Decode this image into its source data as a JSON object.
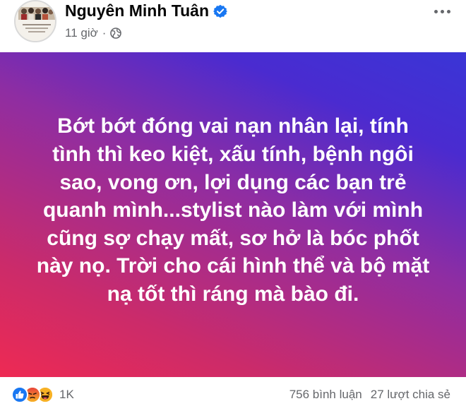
{
  "post": {
    "author": "Nguyên Minh Tuân",
    "timestamp": "11 giờ",
    "verified": true,
    "audience_icon": "globe-icon",
    "banner_text": "Bớt bớt đóng vai nạn nhân lại, tính tình thì keo kiệt, xấu tính, bệnh ngôi sao, vong ơn, lợi dụng các bạn trẻ quanh mình...stylist nào làm với mình cũng sợ chạy mất, sơ hở là bóc phốt này nọ. Trời cho cái hình thể và bộ mặt nạ tốt thì ráng mà bào đi.",
    "banner_colors": [
      "#ee2a53",
      "#8f2da2",
      "#3a35d6"
    ]
  },
  "footer": {
    "reactions": [
      "like-icon",
      "angry-icon",
      "haha-icon"
    ],
    "reaction_count": "1K",
    "comments": "756 bình luận",
    "shares": "27 lượt chia sẻ"
  },
  "colors": {
    "accent": "#1877f2",
    "muted": "#65676b"
  }
}
